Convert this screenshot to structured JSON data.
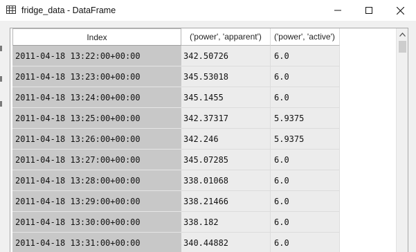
{
  "window": {
    "title": "fridge_data - DataFrame",
    "icons": {
      "app": "table-grid-icon",
      "minimize": "minimize-icon",
      "maximize": "maximize-icon",
      "close": "close-icon",
      "scroll_up": "chevron-up-icon"
    }
  },
  "table": {
    "headers": {
      "index": "Index",
      "apparent": "('power', 'apparent')",
      "active": "('power', 'active')"
    },
    "rows": [
      {
        "index": "2011-04-18 13:22:00+00:00",
        "apparent": "342.50726",
        "active": "6.0"
      },
      {
        "index": "2011-04-18 13:23:00+00:00",
        "apparent": "345.53018",
        "active": "6.0"
      },
      {
        "index": "2011-04-18 13:24:00+00:00",
        "apparent": "345.1455",
        "active": "6.0"
      },
      {
        "index": "2011-04-18 13:25:00+00:00",
        "apparent": "342.37317",
        "active": "5.9375"
      },
      {
        "index": "2011-04-18 13:26:00+00:00",
        "apparent": "342.246",
        "active": "5.9375"
      },
      {
        "index": "2011-04-18 13:27:00+00:00",
        "apparent": "345.07285",
        "active": "6.0"
      },
      {
        "index": "2011-04-18 13:28:00+00:00",
        "apparent": "338.01068",
        "active": "6.0"
      },
      {
        "index": "2011-04-18 13:29:00+00:00",
        "apparent": "338.21466",
        "active": "6.0"
      },
      {
        "index": "2011-04-18 13:30:00+00:00",
        "apparent": "338.182",
        "active": "6.0"
      },
      {
        "index": "2011-04-18 13:31:00+00:00",
        "apparent": "340.44882",
        "active": "6.0"
      }
    ]
  },
  "colors": {
    "index_cell_bg": "#c8c8c8",
    "data_cell_bg": "#ececec",
    "panel_bg": "#f0f0f0",
    "scroll_thumb": "#cdcdcd"
  }
}
